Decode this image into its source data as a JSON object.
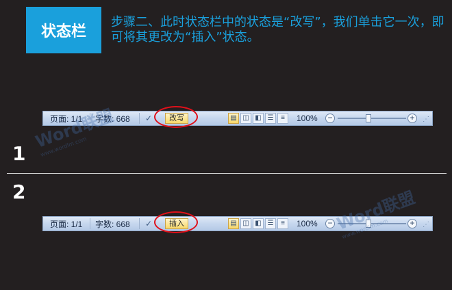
{
  "header": {
    "title": "状态栏",
    "instruction": "步骤二、此时状态栏中的状态是“改写”，我们单击它一次，即可将其更改为“插入”状态。"
  },
  "steps": [
    {
      "number": "1",
      "statusbar": {
        "page": "页面: 1/1",
        "words": "字数: 668",
        "mode": "改写",
        "zoom": "100%",
        "zoom_fraction": 0.45
      }
    },
    {
      "number": "2",
      "statusbar": {
        "page": "页面: 1/1",
        "words": "字数: 668",
        "mode": "插入",
        "zoom": "100%",
        "zoom_fraction": 0.45
      }
    }
  ],
  "watermarks": [
    {
      "text": "Word联盟",
      "sub": "www.wordlm.com"
    },
    {
      "text": "Word联盟",
      "sub": "www.wordlm.com"
    }
  ],
  "icons": {
    "proofing": "proofing-check-icon",
    "views": [
      "print-layout-icon",
      "full-screen-reading-icon",
      "web-layout-icon",
      "outline-icon",
      "draft-icon"
    ]
  },
  "colors": {
    "accent": "#1aa0dc",
    "highlight_ring": "#e0101a",
    "statusbar_bg": "#c6d7ee"
  }
}
